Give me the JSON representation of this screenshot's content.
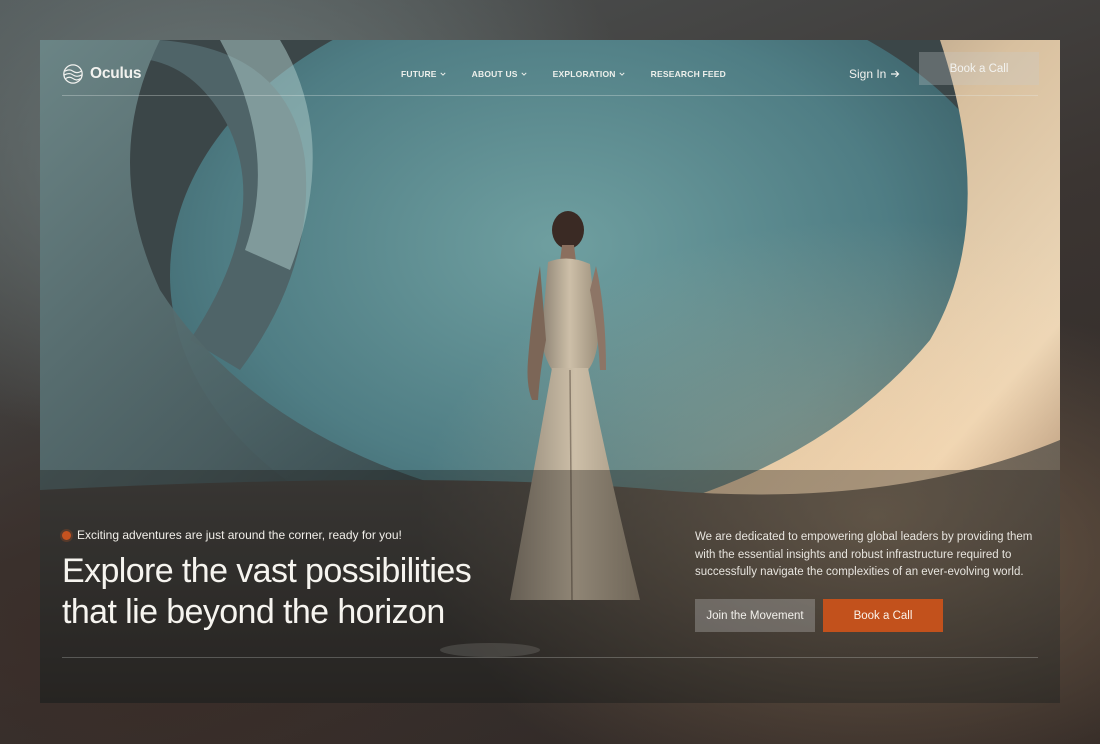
{
  "brand": {
    "name": "Oculus"
  },
  "nav": {
    "items": [
      {
        "label": "FUTURE",
        "has_dropdown": true
      },
      {
        "label": "ABOUT US",
        "has_dropdown": true
      },
      {
        "label": "EXPLORATION",
        "has_dropdown": true
      },
      {
        "label": "RESEARCH FEED",
        "has_dropdown": false
      }
    ],
    "sign_in": "Sign In",
    "cta": "Book a Call"
  },
  "hero": {
    "eyebrow": "Exciting adventures are just around the corner, ready for you!",
    "headline_line1": "Explore the vast possibilities",
    "headline_line2": "that lie beyond the horizon",
    "description": "We are dedicated to empowering global leaders by providing them with the essential insights and robust infrastructure required to successfully navigate the complexities of an ever-evolving world.",
    "secondary_button": "Join the Movement",
    "primary_button": "Book a Call"
  },
  "colors": {
    "accent": "#c2511c",
    "sky": "#5f8f92",
    "wall_warm": "#d9c3a4"
  },
  "icons": {
    "logo": "wave-globe-icon",
    "dropdown": "chevron-down-icon",
    "sign_in": "arrow-right-icon",
    "eyebrow": "status-dot-icon"
  }
}
